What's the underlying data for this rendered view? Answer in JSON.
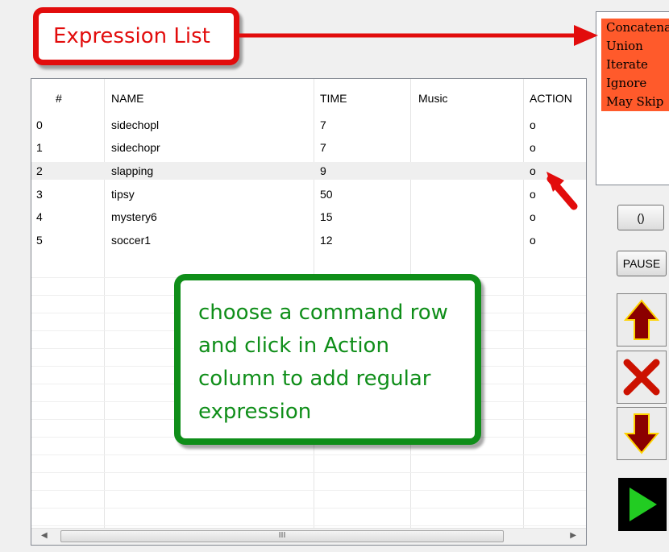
{
  "table": {
    "columns": [
      "#",
      "NAME",
      "TIME",
      "Music",
      "ACTION"
    ],
    "rows": [
      {
        "index": "0",
        "name": "sidechopl",
        "time": "7",
        "music": "",
        "action": "o"
      },
      {
        "index": "1",
        "name": "sidechopr",
        "time": "7",
        "music": "",
        "action": "o"
      },
      {
        "index": "2",
        "name": "slapping",
        "time": "9",
        "music": "",
        "action": "o"
      },
      {
        "index": "3",
        "name": "tipsy",
        "time": "50",
        "music": "",
        "action": "o"
      },
      {
        "index": "4",
        "name": "mystery6",
        "time": "15",
        "music": "",
        "action": "o"
      },
      {
        "index": "5",
        "name": "soccer1",
        "time": "12",
        "music": "",
        "action": "o"
      }
    ],
    "selected_row": 2,
    "scrollbar_thumb_grip": "III"
  },
  "expression_list": {
    "items": [
      "Concatenate",
      "Union",
      "Iterate",
      "Ignore",
      "May Skip"
    ]
  },
  "buttons": {
    "group": "()",
    "pause": "PAUSE"
  },
  "annotations": {
    "expression_list_label": "Expression List",
    "instruction": "choose a command row and click in Action column to add regular expression"
  },
  "colors": {
    "callout_red": "#e20c0c",
    "callout_green": "#0f8e19",
    "list_highlight": "#ff5a2b",
    "up_arrow": "#8b0000",
    "delete_x": "#cc1100",
    "play_arrow": "#22cc22"
  },
  "icons": [
    "up-arrow-icon",
    "delete-x-icon",
    "down-arrow-icon",
    "play-icon",
    "scroll-left-icon",
    "scroll-right-icon"
  ]
}
